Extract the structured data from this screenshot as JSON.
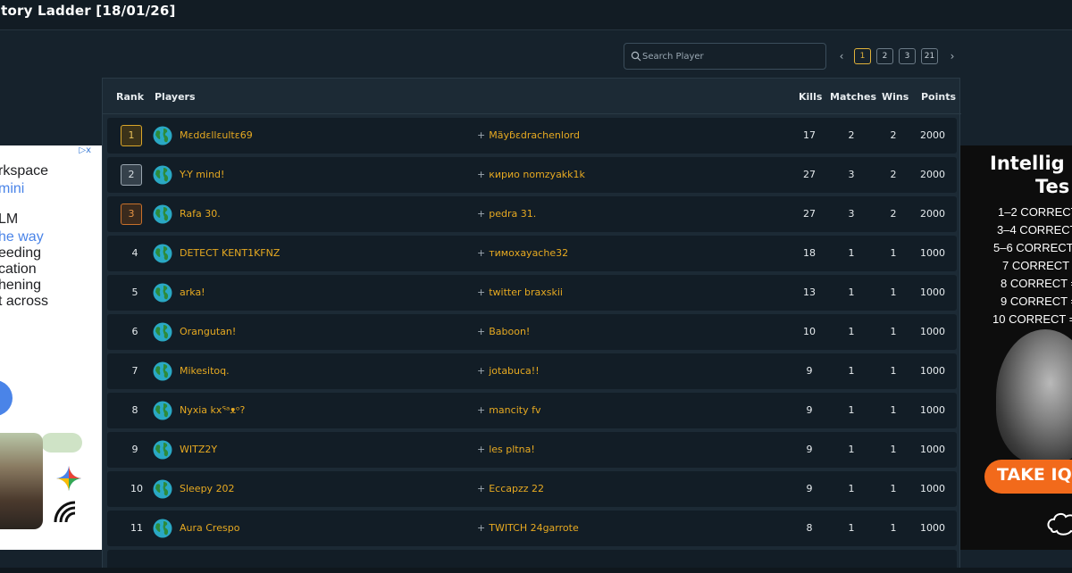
{
  "header": {
    "title": "ctory Ladder [18/01/26]"
  },
  "search": {
    "placeholder": "Search Player",
    "icon": "search-icon"
  },
  "pagination": {
    "pages": [
      "1",
      "2",
      "3",
      "21"
    ],
    "active": "1",
    "prev": "‹",
    "next": "›"
  },
  "table": {
    "headers": {
      "rank": "Rank",
      "players": "Players",
      "kills": "Kills",
      "matches": "Matches",
      "wins": "Wins",
      "points": "Points"
    },
    "rows": [
      {
        "rank": "1",
        "player1": "Mɛddɛllɛultɛ69",
        "player2": "Mäyɓɛdrachenlord",
        "kills": "17",
        "matches": "2",
        "wins": "2",
        "points": "2000"
      },
      {
        "rank": "2",
        "player1": "Y-Y mind!",
        "player2": "кирио nomzyakk1k",
        "kills": "27",
        "matches": "3",
        "wins": "2",
        "points": "2000"
      },
      {
        "rank": "3",
        "player1": "Rafa 30.",
        "player2": "pedra 31.",
        "kills": "27",
        "matches": "3",
        "wins": "2",
        "points": "2000"
      },
      {
        "rank": "4",
        "player1": "DETECT KENT1KFNZ",
        "player2": "тимохауасhe32",
        "kills": "18",
        "matches": "1",
        "wins": "1",
        "points": "1000"
      },
      {
        "rank": "5",
        "player1": "arka!",
        "player2": "twitter braxskii",
        "kills": "13",
        "matches": "1",
        "wins": "1",
        "points": "1000"
      },
      {
        "rank": "6",
        "player1": "Orangutan!",
        "player2": "Baboon!",
        "kills": "10",
        "matches": "1",
        "wins": "1",
        "points": "1000"
      },
      {
        "rank": "7",
        "player1": "Mikesitoq.",
        "player2": "jotabuca!!",
        "kills": "9",
        "matches": "1",
        "wins": "1",
        "points": "1000"
      },
      {
        "rank": "8",
        "player1": "Nyxia kxᕐᵃᴥᵒ?",
        "player2": "mancity fv",
        "kills": "9",
        "matches": "1",
        "wins": "1",
        "points": "1000"
      },
      {
        "rank": "9",
        "player1": "WITZ2Y",
        "player2": "les pltna!",
        "kills": "9",
        "matches": "1",
        "wins": "1",
        "points": "1000"
      },
      {
        "rank": "10",
        "player1": "Sleepy 202",
        "player2": "Eccapzz 22",
        "kills": "9",
        "matches": "1",
        "wins": "1",
        "points": "1000"
      },
      {
        "rank": "11",
        "player1": "Aura Crespo",
        "player2": "TWITCH 24garrote",
        "kills": "8",
        "matches": "1",
        "wins": "1",
        "points": "1000"
      }
    ]
  },
  "ad_left": {
    "lines": [
      "rkspace",
      "mini",
      "LM",
      "he way",
      "eeding",
      "cation",
      "hening",
      "t across"
    ],
    "adchoice": "▷x"
  },
  "ad_right": {
    "heading1": "Intellig",
    "heading2": "Tes",
    "rows": [
      "1–2 CORRECT",
      "3–4 CORRECT",
      "5–6 CORRECT",
      "7 CORRECT =",
      "8 CORRECT =",
      "9 CORRECT =",
      "10 CORRECT ="
    ],
    "cta": "TAKE IQ"
  },
  "colors": {
    "accent": "#e6a921",
    "gold": "#d9a62a",
    "silver": "#9aa6b0",
    "bronze": "#c8702b",
    "background": "#16222c"
  }
}
